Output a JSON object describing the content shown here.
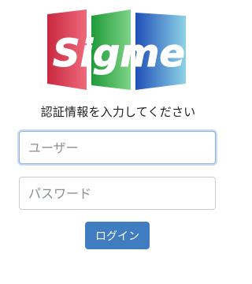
{
  "logo": {
    "text": "Sigme",
    "colors": [
      "#e23a52",
      "#2fb34a",
      "#2f5fc4"
    ]
  },
  "form": {
    "prompt": "認証情報を入力してください",
    "username_placeholder": "ユーザー",
    "password_placeholder": "パスワード",
    "login_label": "ログイン"
  },
  "colors": {
    "button_bg": "#3f7cc0",
    "focus_ring": "#8fb2dd"
  }
}
